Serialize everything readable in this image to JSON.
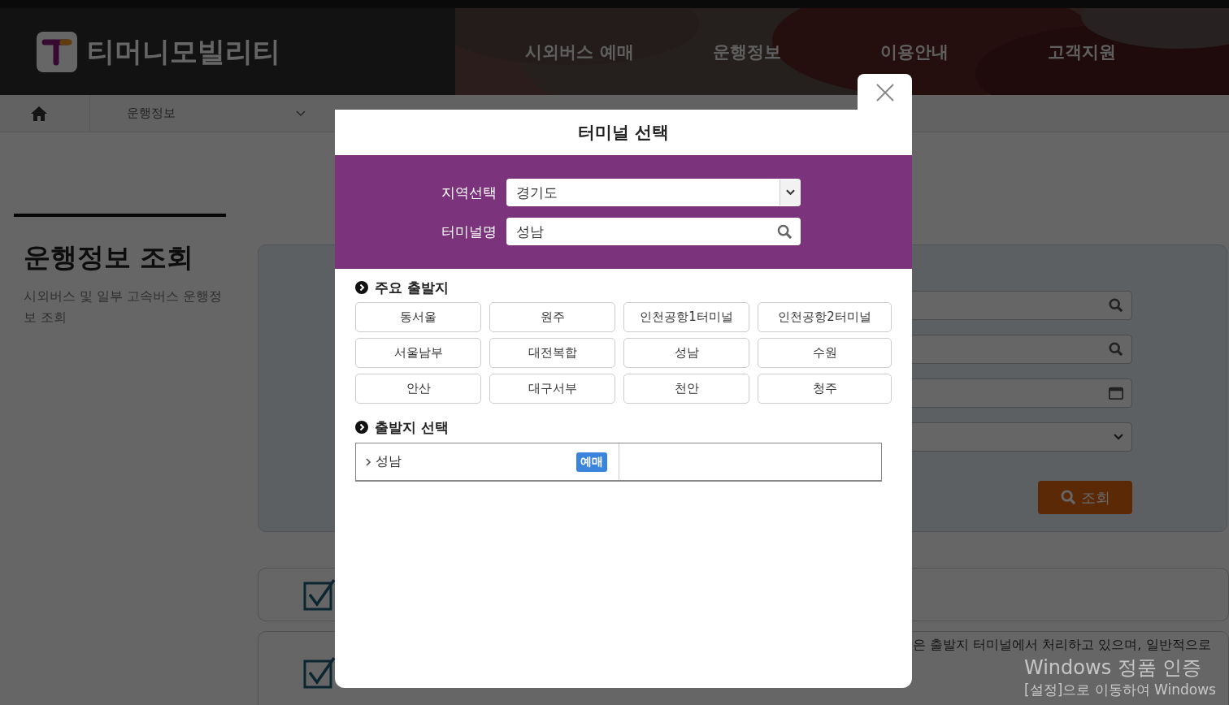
{
  "header": {
    "logo": "티머니모빌리티",
    "nav": [
      "시외버스 예매",
      "운행정보",
      "이용안내",
      "고객지원"
    ]
  },
  "breadcrumb": {
    "items": [
      "운행정보"
    ]
  },
  "page": {
    "title": "운행정보 조회",
    "description": "시외버스 및 일부 고속버스 운행정보 조회"
  },
  "search_form": {
    "button": "조회"
  },
  "notice": {
    "text": "은 출발지 터미널에서 처리하고 있으며, 일반적으로"
  },
  "modal": {
    "title": "터미널 선택",
    "region_label": "지역선택",
    "region_value": "경기도",
    "name_label": "터미널명",
    "name_value": "성남",
    "major_title": "주요 출발지",
    "major": [
      "동서울",
      "원주",
      "인천공항1터미널",
      "인천공항2터미널",
      "서울남부",
      "대전복합",
      "성남",
      "수원",
      "안산",
      "대구서부",
      "천안",
      "청주"
    ],
    "select_title": "출발지 선택",
    "results": [
      {
        "name": "성남",
        "badge": "예매"
      }
    ]
  },
  "os_notice": {
    "title": "Windows 정품 인증",
    "text": "[설정]으로 이동하여 Windows"
  }
}
